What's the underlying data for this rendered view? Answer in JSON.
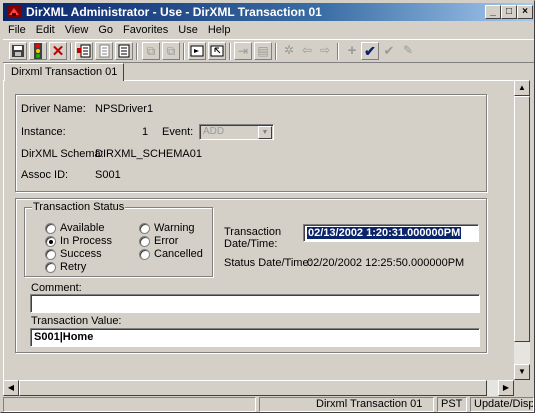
{
  "window": {
    "title": "DirXML Administrator - Use - DirXML Transaction 01",
    "controls": [
      "minimize-icon",
      "maximize-icon",
      "close-icon"
    ]
  },
  "menu": [
    "File",
    "Edit",
    "View",
    "Go",
    "Favorites",
    "Use",
    "Help"
  ],
  "toolbar": {
    "icons": [
      "save-icon",
      "traffic-light-icon",
      "delete-icon",
      "new-record-icon",
      "record-icon",
      "list-icon",
      "copy-icon",
      "paste-icon",
      "goto-icon",
      "goto-back-icon",
      "import-icon",
      "export-icon",
      "settings-icon",
      "back-icon",
      "forward-icon",
      "add-icon",
      "check-icon",
      "check-all-icon",
      "edit-icon"
    ]
  },
  "tab": {
    "label": "Dirxml Transaction 01"
  },
  "driver": {
    "name_label": "Driver Name:",
    "name_value": "NPSDriver1",
    "instance_label": "Instance:",
    "instance_value": "1",
    "event_label": "Event:",
    "event_value": "ADD",
    "schema_label": "DirXML Schema:",
    "schema_value": "DIRXML_SCHEMA01",
    "assoc_label": "Assoc ID:",
    "assoc_value": "S001"
  },
  "transaction_status": {
    "legend": "Transaction Status",
    "options": [
      "Available",
      "In Process",
      "Success",
      "Retry",
      "Warning",
      "Error",
      "Cancelled"
    ],
    "selected": "In Process"
  },
  "datetime": {
    "transaction_label_1": "Transaction",
    "transaction_label_2": "Date/Time:",
    "transaction_value": "02/13/2002  1:20:31.000000PM",
    "status_label": "Status Date/Time:",
    "status_value": "02/20/2002 12:25:50.000000PM"
  },
  "comment": {
    "label": "Comment:",
    "value": ""
  },
  "transaction_value": {
    "label": "Transaction Value:",
    "value": "S001|Home"
  },
  "statusbar": {
    "panes": [
      "",
      "Dirxml Transaction 01",
      "PST",
      "Update/Disp"
    ]
  }
}
